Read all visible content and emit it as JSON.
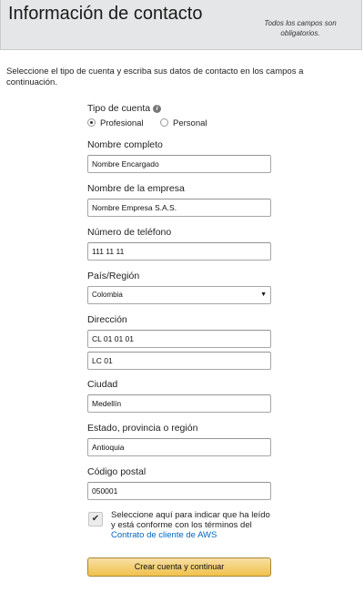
{
  "header": {
    "title": "Información de contacto",
    "required_note": "Todos los campos son obligatorios."
  },
  "intro": "Seleccione el tipo de cuenta y escriba sus datos de contacto en los campos a continuación.",
  "account_type": {
    "label": "Tipo de cuenta",
    "info_icon": "info-icon",
    "options": [
      {
        "label": "Profesional",
        "selected": true
      },
      {
        "label": "Personal",
        "selected": false
      }
    ]
  },
  "fields": {
    "full_name": {
      "label": "Nombre completo",
      "value": "Nombre Encargado"
    },
    "company": {
      "label": "Nombre de la empresa",
      "value": "Nombre Empresa S.A.S."
    },
    "phone": {
      "label": "Número de teléfono",
      "value": "111 11 11"
    },
    "country": {
      "label": "País/Región",
      "value": "Colombia"
    },
    "address": {
      "label": "Dirección",
      "line1": "CL 01 01 01",
      "line2": "LC 01"
    },
    "city": {
      "label": "Ciudad",
      "value": "Medellín"
    },
    "state": {
      "label": "Estado, provincia o región",
      "value": "Antioquia"
    },
    "postal": {
      "label": "Código postal",
      "value": "050001"
    }
  },
  "terms": {
    "checked": true,
    "text": "Seleccione aquí para indicar que ha leído y está conforme con los términos del",
    "link": "Contrato de cliente de AWS"
  },
  "submit_label": "Crear cuenta y continuar"
}
